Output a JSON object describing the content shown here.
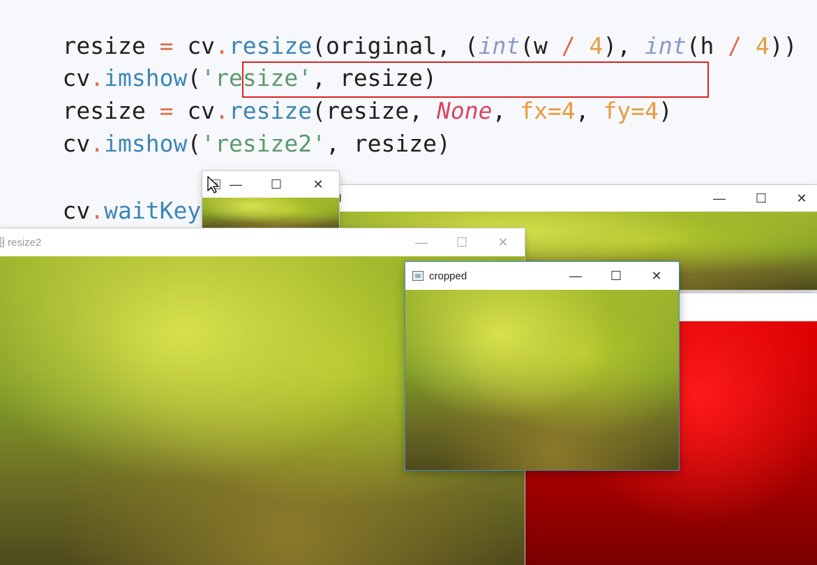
{
  "code": {
    "line1": [
      "resize",
      " = ",
      "cv",
      ".",
      "resize",
      "(original, (",
      "int",
      "(w ",
      "/",
      " ",
      "4",
      "), ",
      "int",
      "(h ",
      "/",
      " ",
      "4",
      "))"
    ],
    "line2": [
      "cv",
      ".",
      "imshow",
      "(",
      "'resize'",
      ", resize)"
    ],
    "line3": [
      "resize",
      " = ",
      "cv",
      ".",
      "resize",
      "(resize, ",
      "None",
      ", ",
      "fx=4",
      ", ",
      "fy=4",
      ")"
    ],
    "line4": [
      "cv",
      ".",
      "imshow",
      "(",
      "'resize2'",
      ", resize)"
    ],
    "line5": [
      "cv",
      ".",
      "waitKey",
      "()"
    ]
  },
  "windows": {
    "small": {
      "title": ""
    },
    "original": {
      "title": "l"
    },
    "resize2": {
      "title": "resize2"
    },
    "cropped": {
      "title": "cropped"
    },
    "red": {
      "title": ""
    }
  },
  "controls": {
    "minimize": "—",
    "maximize": "☐",
    "close": "✕"
  },
  "colors": {
    "highlight": "#e02020",
    "func": "#3a86b8",
    "string": "#5b9a6a",
    "number": "#e69b3e",
    "none": "#d9455f"
  },
  "icons": {
    "app": "opencv-window-icon",
    "cursor": "mouse-pointer-icon"
  }
}
